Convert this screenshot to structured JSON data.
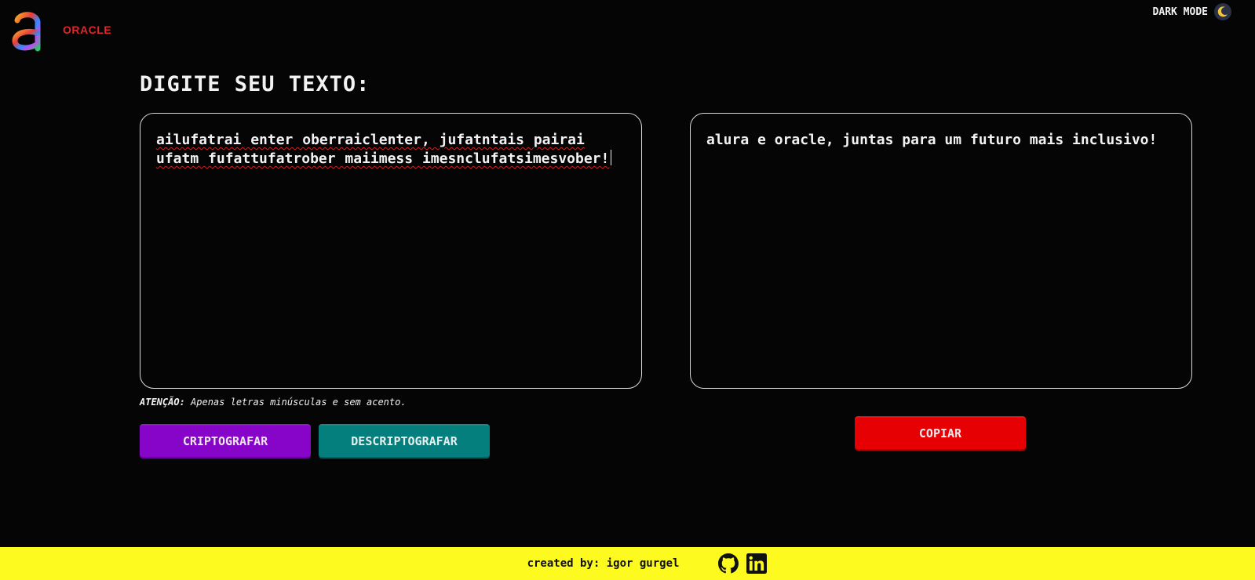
{
  "header": {
    "oracle_label": "ORACLE",
    "dark_mode_label": "DARK MODE",
    "dark_mode_icon": "moon-icon"
  },
  "main": {
    "heading": "DIGITE SEU TEXTO:",
    "input_text": "ailufatrai enter oberraiclenter, jufatntais pairai ufatm fufattufatrober maiimess imesnclufatsimesvober!",
    "output_text": "alura e oracle, juntas para um futuro mais inclusivo!",
    "warning_label": "ATENÇÃO:",
    "warning_text": "Apenas letras minúsculas e sem acento.",
    "encrypt_button": "CRIPTOGRAFAR",
    "decrypt_button": "DESCRIPTOGRAFAR",
    "copy_button": "COPIAR"
  },
  "footer": {
    "credit": "created by: igor gurgel",
    "icons": [
      "github-icon",
      "linkedin-icon"
    ]
  },
  "colors": {
    "background": "#050505",
    "encrypt": "#8705c8",
    "decrypt": "#047f7e",
    "copy": "#e70003",
    "footer": "#fdfa1f",
    "oracle_red": "#e0262b"
  }
}
